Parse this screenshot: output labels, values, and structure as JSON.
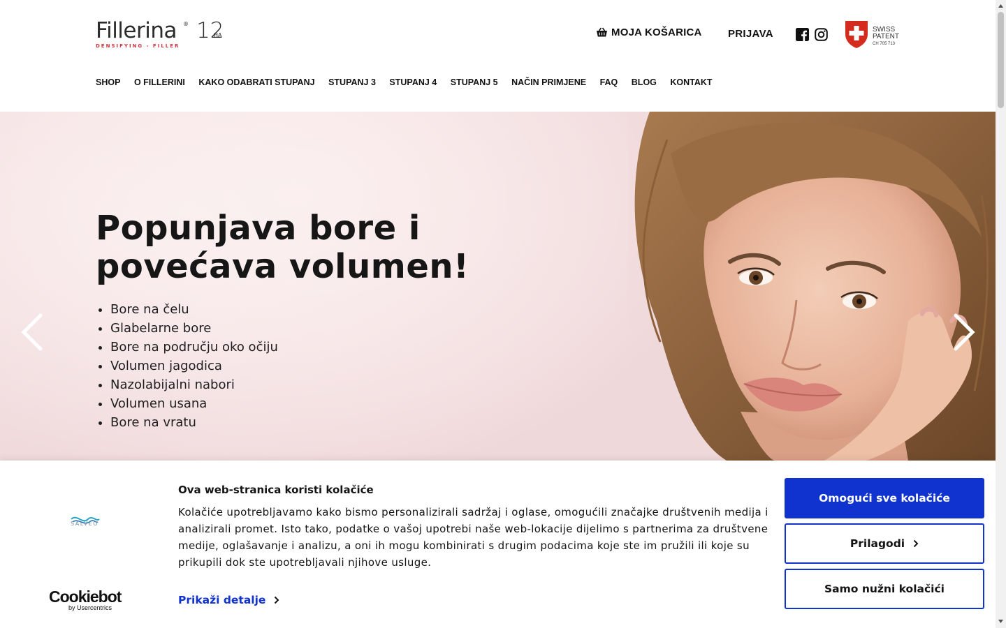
{
  "header": {
    "logo": {
      "name": "Fillerina",
      "number": "12",
      "ha": "HA",
      "tagline": "DENSIFYING - FILLER"
    },
    "cart_label": "MOJA KOŠARICA",
    "login_label": "PRIJAVA",
    "swiss_badge": {
      "line1": "SWISS",
      "line2": "PATENT",
      "line3": "CH 705 713"
    }
  },
  "nav": [
    {
      "label": "SHOP"
    },
    {
      "label": "O FILLERINI"
    },
    {
      "label": "KAKO ODABRATI STUPANJ"
    },
    {
      "label": "STUPANJ 3"
    },
    {
      "label": "STUPANJ 4"
    },
    {
      "label": "STUPANJ 5"
    },
    {
      "label": "NAČIN PRIMJENE"
    },
    {
      "label": "FAQ"
    },
    {
      "label": "BLOG"
    },
    {
      "label": "KONTAKT"
    }
  ],
  "hero": {
    "title_line1": "Popunjava bore i",
    "title_line2": "povećava volumen!",
    "items": [
      "Bore na čelu",
      "Glabelarne bore",
      "Bore na području oko očiju",
      "Volumen jagodica",
      "Nazolabijalni nabori",
      "Volumen usana",
      "Bore na vratu"
    ]
  },
  "cookie": {
    "brand": "SALVEO",
    "cookiebot_main": "Cookiebot",
    "cookiebot_sub": "by Usercentrics",
    "title": "Ova web-stranica koristi kolačiće",
    "text": "Kolačiće upotrebljavamo kako bismo personalizirali sadržaj i oglase, omogućili značajke društvenih medija i analizirali promet. Isto tako, podatke o vašoj upotrebi naše web-lokacije dijelimo s partnerima za društvene medije, oglašavanje i analizu, a oni ih mogu kombinirati s drugim podacima koje ste im pružili ili koje su prikupili dok ste upotrebljavali njihove usluge.",
    "details_label": "Prikaži detalje",
    "allow_all_label": "Omogući sve kolačiće",
    "customize_label": "Prilagodi",
    "necessary_label": "Samo nužni kolačići"
  },
  "colors": {
    "accent_blue": "#1032cf",
    "logo_red": "#d0363f",
    "hero_pink": "#f6e3e4",
    "swiss_red": "#d52b1e"
  },
  "icons": [
    "basket-icon",
    "facebook-icon",
    "instagram-icon",
    "swiss-cross-icon",
    "chevron-left-icon",
    "chevron-right-icon",
    "salveo-wave-icon"
  ]
}
